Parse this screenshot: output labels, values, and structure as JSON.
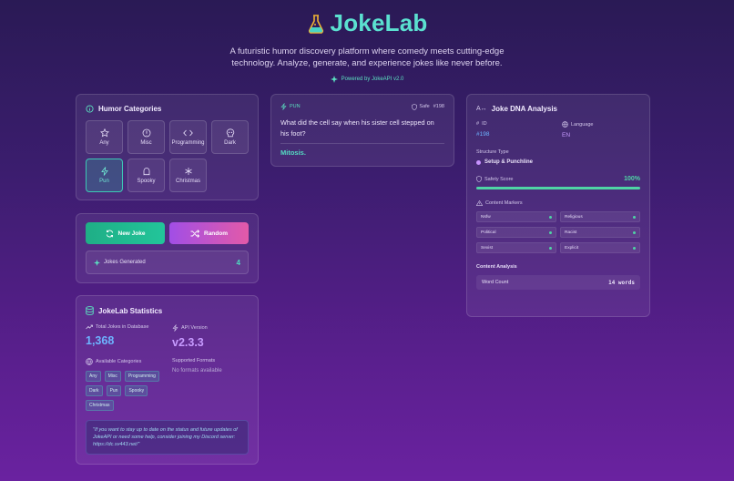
{
  "header": {
    "app_name": "JokeLab",
    "tagline_line1": "A futuristic humor discovery platform where comedy meets cutting-edge",
    "tagline_line2": "technology. Analyze, generate, and experience jokes like never before.",
    "powered_by": "Powered by JokeAPI v2.0"
  },
  "categories": {
    "title": "Humor Categories",
    "items": [
      {
        "label": "Any",
        "icon": "star-icon",
        "active": false
      },
      {
        "label": "Misc",
        "icon": "circle-info-icon",
        "active": false
      },
      {
        "label": "Programming",
        "icon": "code-icon",
        "active": false
      },
      {
        "label": "Dark",
        "icon": "skull-icon",
        "active": false
      },
      {
        "label": "Pun",
        "icon": "zap-icon",
        "active": true
      },
      {
        "label": "Spooky",
        "icon": "ghost-icon",
        "active": false
      },
      {
        "label": "Christmas",
        "icon": "snowflake-icon",
        "active": false
      }
    ]
  },
  "actions": {
    "new_joke": "New Joke",
    "random": "Random",
    "jokes_generated_label": "Jokes Generated",
    "jokes_generated_value": "4"
  },
  "stats": {
    "title": "JokeLab Statistics",
    "total_label": "Total Jokes in Database",
    "total_value": "1,368",
    "api_label": "API Version",
    "api_value": "v2.3.3",
    "available_label": "Available Categories",
    "available": [
      "Any",
      "Misc",
      "Programming",
      "Dark",
      "Pun",
      "Spooky",
      "Christmas"
    ],
    "formats_label": "Supported Formats",
    "formats_value": "No formats available",
    "quote": "\"If you want to stay up to date on the status and future updates of JokeAPI or need some help, consider joining my Discord server: https://dc.sv443.net/\""
  },
  "joke": {
    "category": "PUN",
    "safe_label": "Safe",
    "id": "#198",
    "setup": "What did the cell say when his sister cell stepped on his foot?",
    "delivery": "Mitosis."
  },
  "dna": {
    "title": "Joke DNA Analysis",
    "id_label": "ID",
    "id_value": "#198",
    "language_label": "Language",
    "language_value": "EN",
    "structure_label": "Structure Type",
    "structure_value": "Setup & Punchline",
    "safety_label": "Safety Score",
    "safety_value": "100%",
    "safety_fraction": 1.0,
    "markers_label": "Content Markers",
    "markers": [
      "Nsfw",
      "Religious",
      "Political",
      "Racist",
      "Sexist",
      "Explicit"
    ],
    "analysis_label": "Content Analysis",
    "word_count_label": "Word Count",
    "word_count_value": "14 words"
  },
  "colors": {
    "accent": "#5be0d0",
    "new_joke": "#22c59a",
    "random_start": "#a14ee6",
    "random_end": "#e35aa8",
    "structure_dot": "#c792ff",
    "ok": "#4fd4a5"
  }
}
